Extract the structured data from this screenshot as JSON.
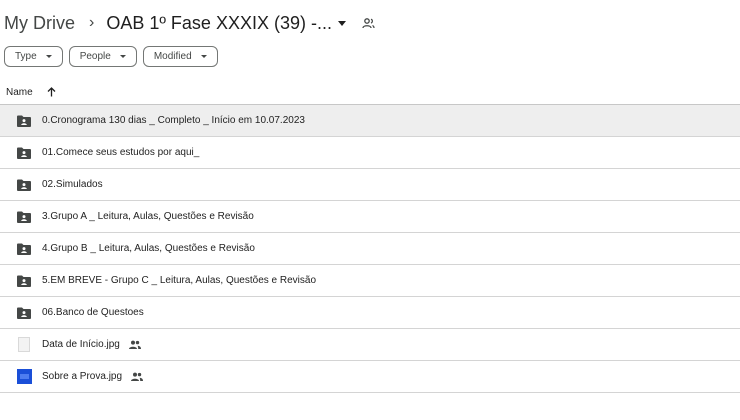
{
  "breadcrumb": {
    "root": "My Drive",
    "separator": "›",
    "current": "OAB 1º Fase XXXIX (39) -..."
  },
  "filters": [
    {
      "label": "Type"
    },
    {
      "label": "People"
    },
    {
      "label": "Modified"
    }
  ],
  "list_header": {
    "name_label": "Name",
    "sort": "ascending"
  },
  "items": [
    {
      "kind": "shared-folder",
      "name": "0.Cronograma 130 dias _ Completo _ Início em 10.07.2023",
      "selected": true
    },
    {
      "kind": "shared-folder",
      "name": "01.Comece seus estudos por aqui_"
    },
    {
      "kind": "shared-folder",
      "name": "02.Simulados"
    },
    {
      "kind": "shared-folder",
      "name": "3.Grupo A _ Leitura, Aulas, Questões e Revisão"
    },
    {
      "kind": "shared-folder",
      "name": "4.Grupo B _ Leitura, Aulas, Questões e Revisão"
    },
    {
      "kind": "shared-folder",
      "name": "5.EM BREVE - Grupo C _ Leitura, Aulas, Questões e Revisão"
    },
    {
      "kind": "shared-folder",
      "name": "06.Banco de Questoes"
    },
    {
      "kind": "image",
      "name": "Data de Início.jpg",
      "shared": true
    },
    {
      "kind": "image",
      "name": "Sobre a Prova.jpg",
      "shared": true
    }
  ],
  "colors": {
    "text": "#1f1f1f",
    "selected_row": "#eeeeee",
    "folder_icon": "#444746",
    "divider": "#d4d4d4"
  }
}
